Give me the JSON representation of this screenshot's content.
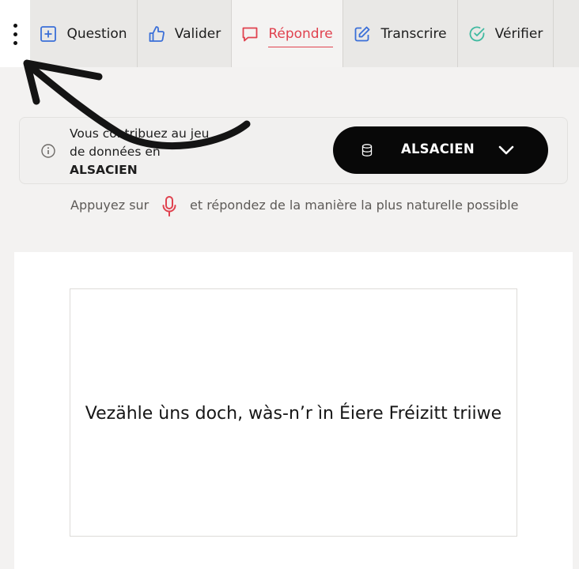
{
  "nav": {
    "tabs": [
      {
        "label": "Question",
        "icon": "plus-square-icon"
      },
      {
        "label": "Valider",
        "icon": "thumbs-up-icon"
      },
      {
        "label": "Répondre",
        "icon": "chat-bubble-icon",
        "active": true
      },
      {
        "label": "Transcrire",
        "icon": "edit-icon"
      },
      {
        "label": "Vérifier",
        "icon": "check-circle-icon"
      }
    ]
  },
  "contribution": {
    "text_line1": "Vous contribuez au jeu",
    "text_line2": "de données en",
    "language_bold": "ALSACIEN",
    "selector_label": "ALSACIEN"
  },
  "hint": {
    "before": "Appuyez sur",
    "after": "et répondez de la manière la plus naturelle possible"
  },
  "sentence": "Vezähle ùns doch, wàs-n’r ìn Éiere Fréizitt triiwe",
  "colors": {
    "accent": "#e0424f",
    "blue_icon": "#3a6fd8",
    "teal_icon": "#3fb9a0",
    "pill": "#080808"
  }
}
